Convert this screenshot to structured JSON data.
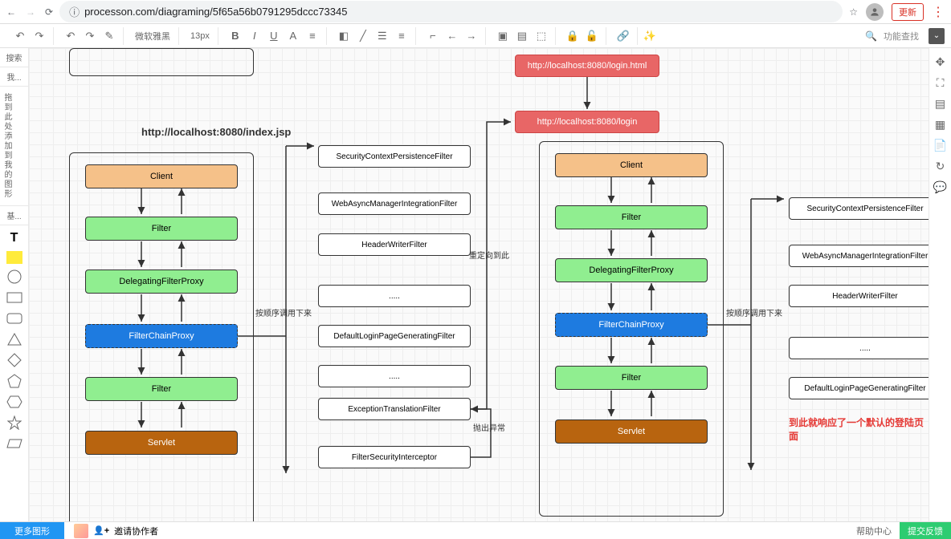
{
  "browser": {
    "url": "processon.com/diagraming/5f65a56b0791295dccc73345",
    "update_label": "更新"
  },
  "toolbar": {
    "font_name": "微软雅黑",
    "font_size": "13px",
    "search_label": "功能查找"
  },
  "left_rail": {
    "search": "搜索",
    "my": "我...",
    "drag_hint": "拖到此处添加到我的图形",
    "basic": "基..."
  },
  "diagram": {
    "top_red1": "http://localhost:8080/login.html",
    "top_red2": "http://localhost:8080/login",
    "title_left": "http://localhost:8080/index.jsp",
    "left_stack": {
      "client": "Client",
      "filter1": "Filter",
      "delegating": "DelegatingFilterProxy",
      "chainproxy": "FilterChainProxy",
      "filter2": "Filter",
      "servlet": "Servlet"
    },
    "mid_stack": {
      "f1": "SecurityContextPersistenceFilter",
      "f2": "WebAsyncManagerIntegrationFilter",
      "f3": "HeaderWriterFilter",
      "f4": ".....",
      "f5": "DefaultLoginPageGeneratingFilter",
      "f6": ".....",
      "f7": "ExceptionTranslationFilter",
      "f8": "FilterSecurityInterceptor"
    },
    "right_stack": {
      "client": "Client",
      "filter": "Filter",
      "delegating": "DelegatingFilterProxy",
      "chainproxy": "FilterChainProxy",
      "filter2": "Filter",
      "servlet": "Servlet"
    },
    "far_stack": {
      "f1": "SecurityContextPersistenceFilter",
      "f2": "WebAsyncManagerIntegrationFilter",
      "f3": "HeaderWriterFilter",
      "f4": ".....",
      "f5": "DefaultLoginPageGeneratingFilter"
    },
    "labels": {
      "seq_call": "按顺序调用下来",
      "seq_call2": "按顺序调用下来",
      "redirect": "重定向到此",
      "throw_ex": "抛出异常",
      "red_note": "到此就响应了一个默认的登陆页面"
    }
  },
  "bottom": {
    "more_shapes": "更多图形",
    "invite": "邀请协作者",
    "help": "帮助中心",
    "feedback": "提交反馈"
  }
}
